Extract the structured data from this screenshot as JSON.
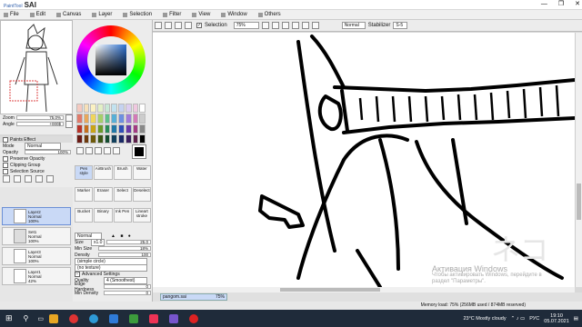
{
  "app": {
    "logo": "SAI",
    "logo_sub": "PaintTool",
    "window_buttons": [
      "—",
      "❐",
      "✕"
    ]
  },
  "menu": [
    "File",
    "Edit",
    "Canvas",
    "Layer",
    "Selection",
    "Filter",
    "View",
    "Window",
    "Others"
  ],
  "canvas_toolbar": {
    "selection_label": "Selection",
    "zoom": "75%",
    "blend": "Normal",
    "stabilizer_label": "Stabilizer",
    "stabilizer_value": "S-5"
  },
  "navigator": {
    "zoom_label": "Zoom",
    "zoom_value": "75.0%",
    "angle_label": "Angle",
    "angle_value": "+000$"
  },
  "effects": {
    "title": "Paints Effect",
    "mode_label": "Mode",
    "mode_value": "Normal",
    "opacity_label": "Opacity",
    "opacity_value": "100%",
    "checks": [
      "Preserve Opacity",
      "Clipping Group",
      "Selection Source"
    ]
  },
  "layers": [
    {
      "name": "Layer2",
      "mode": "Normal",
      "opacity": "100%",
      "selected": true
    },
    {
      "name": "Set1",
      "mode": "Normal",
      "opacity": "100%",
      "selected": false
    },
    {
      "name": "Layer3",
      "mode": "Normal",
      "opacity": "100%",
      "selected": false
    },
    {
      "name": "Layer1",
      "mode": "Normal",
      "opacity": "42%",
      "selected": false
    }
  ],
  "tools": [
    {
      "label": "Pen\nstyle",
      "sel": true
    },
    {
      "label": "AirBrush",
      "sel": false
    },
    {
      "label": "Brush",
      "sel": false
    },
    {
      "label": "Water",
      "sel": false
    },
    {
      "label": "Marker",
      "sel": false
    },
    {
      "label": "Eraser",
      "sel": false
    },
    {
      "label": "Select",
      "sel": false
    },
    {
      "label": "Deselect",
      "sel": false
    },
    {
      "label": "Bucket",
      "sel": false
    },
    {
      "label": "Binary",
      "sel": false
    },
    {
      "label": "Ink Pen",
      "sel": false
    },
    {
      "label": "Lineart\nstroke",
      "sel": false
    }
  ],
  "brush": {
    "blend": "Normal",
    "size_label": "Size",
    "size_mult": "x1.0",
    "size_value": "25.0",
    "minsize_label": "Min Size",
    "minsize_value": "18%",
    "density_label": "Density",
    "density_value": "100",
    "shape": "(simple circle)",
    "texture": "(no texture)",
    "advanced_label": "Advanced Settings",
    "quality_label": "Quality",
    "quality_value": "4 (Smoothest)",
    "edge_label": "Edge Hardness",
    "edge_value": "0",
    "mindensity_label": "Min Density",
    "mindensity_value": "0"
  },
  "tab": {
    "name": "pangom.sai",
    "zoom": "75%"
  },
  "status": {
    "text": "Memory load: 75% (256MB used / 874MB reserved)"
  },
  "activation": {
    "title": "Активация Windows",
    "line1": "Чтобы активировать Windows, перейдите в",
    "line2": "раздел \"Параметры\"."
  },
  "watermark": "ネコ",
  "taskbar": {
    "weather": "23°C  Mostly cloudy",
    "lang": "РУС",
    "time": "19:10",
    "date": "05.07.2021"
  },
  "colors": {
    "accent": "#c9d9f6",
    "taskbar": "#1f2b3a"
  }
}
